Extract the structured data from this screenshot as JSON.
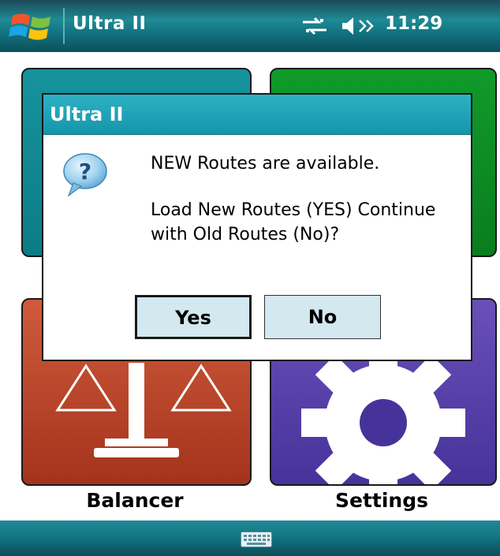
{
  "statusbar": {
    "title": "Ultra II",
    "time": "11:29",
    "start_icon": "windows-flag-icon",
    "connectivity_icon": "connectivity-icon",
    "volume_icon": "speaker-icon"
  },
  "tiles": [
    {
      "label": "",
      "icon": "hidden-tile-icon",
      "color": "#0c7c86"
    },
    {
      "label": "",
      "icon": "hidden-tile-icon",
      "color": "#0a7d1f"
    },
    {
      "label": "Balancer",
      "icon": "scale-icon",
      "color": "#a4331c"
    },
    {
      "label": "Settings",
      "icon": "gear-icon",
      "color": "#46339a"
    }
  ],
  "dialog": {
    "title": "Ultra II",
    "icon": "question-bubble-icon",
    "message_line1": "NEW Routes are available.",
    "message_line2": "Load New Routes (YES) Continue with Old Routes (No)?",
    "yes_label": "Yes",
    "no_label": "No"
  },
  "bottombar": {
    "keyboard_icon": "keyboard-icon"
  },
  "colors": {
    "accent": "#1595aa",
    "button_bg": "#d3e8ef"
  }
}
